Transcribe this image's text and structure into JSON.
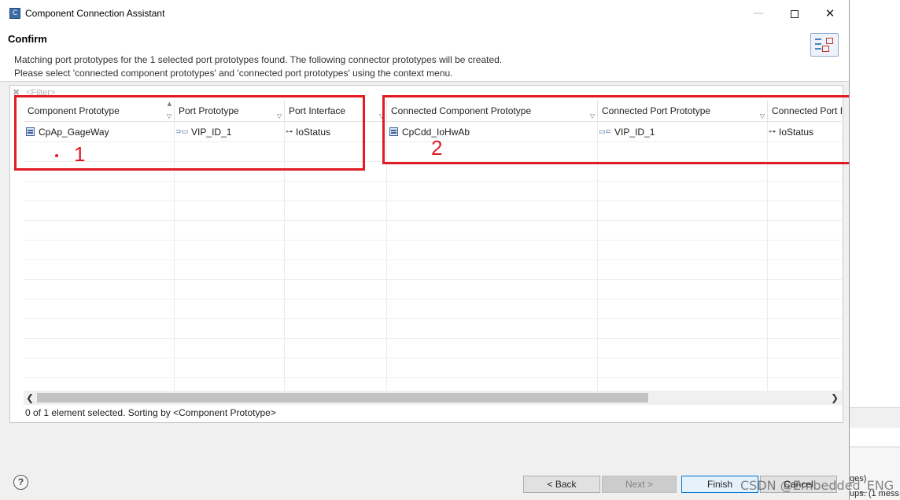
{
  "window": {
    "title": "Component Connection Assistant",
    "app_icon_glyph": "C",
    "minimize_glyph": "—",
    "close_glyph": "✕"
  },
  "header": {
    "title": "Confirm",
    "message_line1": "Matching port prototypes for the 1 selected port prototypes found. The following connector prototypes will be created.",
    "message_line2": "Please select 'connected component prototypes' and 'connected port prototypes' using the context menu."
  },
  "filter": {
    "placeholder": "<Filter>"
  },
  "table": {
    "columns": [
      "Component Prototype",
      "Port Prototype",
      "Port Interface",
      "Connected Component Prototype",
      "Connected Port Prototype",
      "Connected Port I"
    ],
    "rows": [
      {
        "component_prototype": "CpAp_GageWay",
        "port_prototype": "VIP_ID_1",
        "port_interface": "IoStatus",
        "connected_component_prototype": "CpCdd_IoHwAb",
        "connected_port_prototype": "VIP_ID_1",
        "connected_port_interface": "IoStatus"
      }
    ],
    "status": "0 of 1 element selected. Sorting by <Component Prototype>"
  },
  "annotations": {
    "label_1": "1",
    "label_2": "2",
    "color": "#e01b24"
  },
  "footer": {
    "help_label": "?",
    "back_label": "< Back",
    "next_label": "Next >",
    "finish_label": "Finish",
    "cancel_label": "Cancel"
  },
  "background": {
    "text1": "ges)",
    "text2": "ups. (1 mess"
  },
  "watermark": "CSDN @Embedded_ENG",
  "icons": [
    "app-icon",
    "wizard-icon",
    "clear-filter-icon",
    "component-icon",
    "port-icon",
    "interface-icon",
    "filter-icon",
    "sort-icon",
    "scroll-left-icon",
    "scroll-right-icon",
    "help-icon"
  ]
}
